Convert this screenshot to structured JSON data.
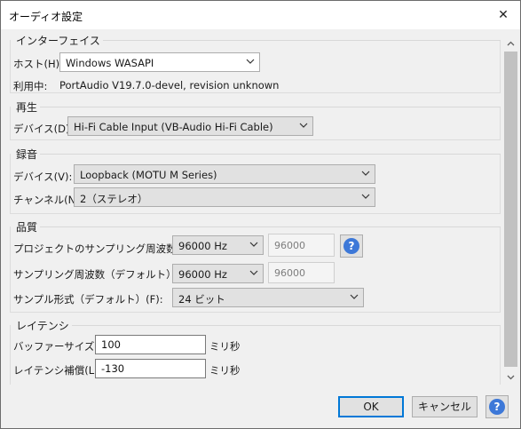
{
  "window": {
    "title": "オーディオ設定",
    "close_glyph": "✕"
  },
  "interface": {
    "section_label": "インターフェイス",
    "host_label": "ホスト(H):",
    "host_value": "Windows WASAPI",
    "using_label": "利用中:",
    "using_value": "PortAudio V19.7.0-devel, revision unknown"
  },
  "playback": {
    "section_label": "再生",
    "device_label": "デバイス(D):",
    "device_value": "Hi-Fi Cable Input (VB-Audio Hi-Fi Cable)"
  },
  "recording": {
    "section_label": "録音",
    "device_label": "デバイス(V):",
    "device_value": "Loopback (MOTU M Series)",
    "channels_label": "チャンネル(N):",
    "channels_value": "2（ステレオ）"
  },
  "quality": {
    "section_label": "品質",
    "project_rate_label": "プロジェクトのサンプリング周波数 (P):",
    "project_rate_value": "96000 Hz",
    "project_rate_custom": "96000",
    "default_rate_label": "サンプリング周波数（デフォルト）(E):",
    "default_rate_value": "96000 Hz",
    "default_rate_custom": "96000",
    "sample_format_label": "サンプル形式（デフォルト）(F):",
    "sample_format_value": "24 ビット",
    "help_glyph": "?"
  },
  "latency": {
    "section_label": "レイテンシ",
    "buffer_label": "バッファーサイズ(B):",
    "buffer_value": "100",
    "buffer_unit": "ミリ秒",
    "compensation_label": "レイテンシ補償(L):",
    "compensation_value": "-130",
    "compensation_unit": "ミリ秒"
  },
  "footer": {
    "ok_label": "OK",
    "cancel_label": "キャンセル",
    "help_glyph": "?"
  },
  "colors": {
    "accent": "#0078d7",
    "help_blue": "#3d78d8",
    "dialog_bg": "#f0f0f0"
  },
  "icons": {
    "dropdown": "chevron-down-icon",
    "help": "help-icon",
    "close": "close-icon"
  }
}
